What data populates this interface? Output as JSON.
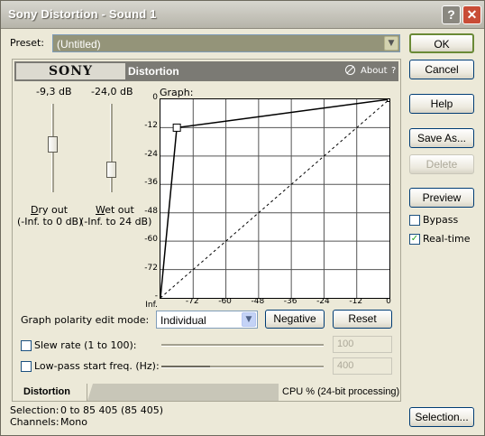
{
  "window": {
    "title": "Sony Distortion - Sound 1",
    "help_glyph": "?",
    "close_glyph": "✕"
  },
  "preset": {
    "label": "Preset:",
    "value": "(Untitled)"
  },
  "plugin": {
    "brand": "SONY",
    "name": "Distortion",
    "about": "About",
    "help": "?"
  },
  "sliders": {
    "dry": {
      "value_text": "-9,3 dB",
      "name": "Dry out",
      "range": "(-Inf. to 0 dB)",
      "level": 0.55
    },
    "wet": {
      "value_text": "-24,0 dB",
      "name": "Wet out",
      "range": "(-Inf. to 24 dB)",
      "level": 0.2
    }
  },
  "graph": {
    "label": "Graph:",
    "y_ticks": [
      "0",
      "-12",
      "-24",
      "-36",
      "-48",
      "-60",
      "-72",
      "-Inf."
    ],
    "x_ticks": [
      "-72",
      "-60",
      "-48",
      "-36",
      "-24",
      "-12",
      "0"
    ]
  },
  "chart_data": {
    "type": "line",
    "xlim": [
      -84,
      0
    ],
    "ylim": [
      -84,
      0
    ],
    "series": [
      {
        "x": [
          -84,
          -78,
          0
        ],
        "y": [
          -84,
          -12,
          0
        ]
      }
    ]
  },
  "polarity": {
    "label": "Graph polarity edit mode:",
    "value": "Individual",
    "negative": "Negative",
    "reset": "Reset"
  },
  "slew": {
    "label": "Slew rate (1 to 100):",
    "value": "100"
  },
  "lowpass": {
    "label": "Low-pass start freq. (Hz):",
    "value": "400"
  },
  "tabs": {
    "active": "Distortion",
    "cpu": "CPU %  (24-bit processing)"
  },
  "buttons": {
    "ok": "OK",
    "cancel": "Cancel",
    "help": "Help",
    "save_as": "Save As...",
    "delete": "Delete",
    "preview": "Preview",
    "selection": "Selection..."
  },
  "checks": {
    "bypass": {
      "label": "Bypass",
      "checked": false
    },
    "realtime": {
      "label": "Real-time",
      "checked": true,
      "mark": "✓"
    }
  },
  "status": {
    "selection_label": "Selection:",
    "selection_value": "0 to 85 405 (85 405)",
    "channels_label": "Channels:",
    "channels_value": "Mono"
  }
}
